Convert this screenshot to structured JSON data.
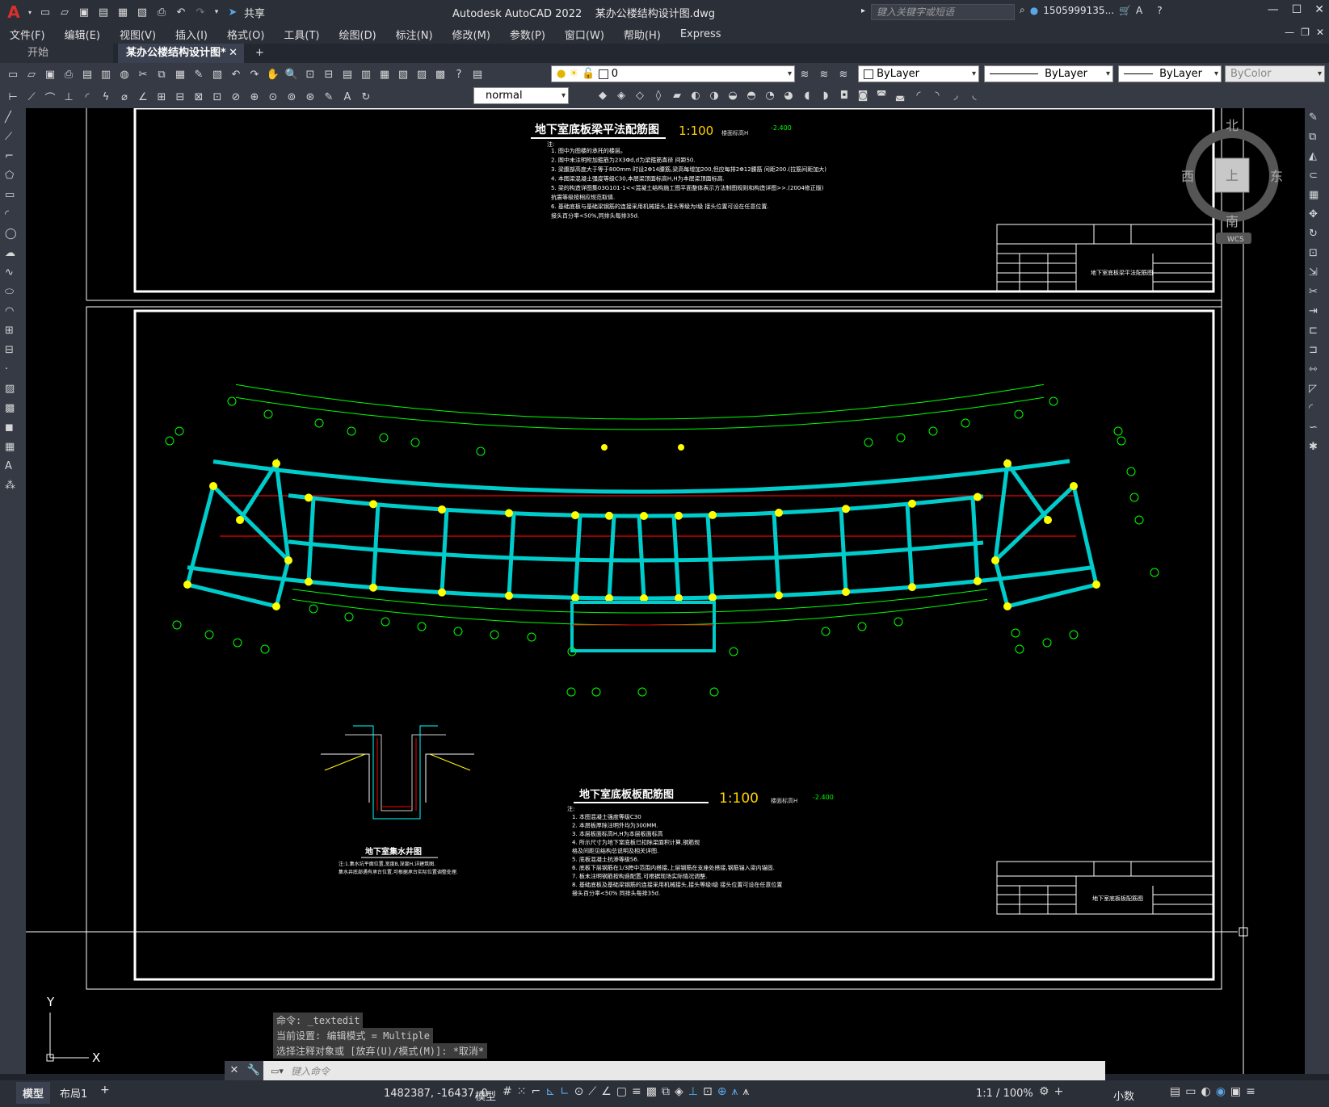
{
  "titlebar": {
    "app_title": "Autodesk AutoCAD 2022",
    "file_name": "某办公楼结构设计图.dwg",
    "share_label": "共享",
    "search_placeholder": "键入关键字或短语",
    "user": "1505999135..."
  },
  "menu": [
    "文件(F)",
    "编辑(E)",
    "视图(V)",
    "插入(I)",
    "格式(O)",
    "工具(T)",
    "绘图(D)",
    "标注(N)",
    "修改(M)",
    "参数(P)",
    "窗口(W)",
    "帮助(H)",
    "Express"
  ],
  "tabs": {
    "start": "开始",
    "document": "某办公楼结构设计图*"
  },
  "properties": {
    "layer": "0",
    "color": "ByLayer",
    "linetype": "ByLayer",
    "lineweight": "ByLayer",
    "plotstyle": "ByColor",
    "textstyle": "normal"
  },
  "viewcube": {
    "north": "北",
    "south": "南",
    "east": "东",
    "west": "西",
    "top": "上",
    "wcs": "WCS"
  },
  "drawing": {
    "top_title": "地下室底板梁平法配筋图",
    "top_scale": "1:100",
    "top_level_label": "楼面标高H",
    "top_level_value": "-2.400",
    "top_notes_head": "注:",
    "top_notes": [
      "1. 图中为图楼的承托的楼层。",
      "2. 图中未注明附加箍筋为2X3Φd,d为梁箍筋直径 间距50.",
      "3. 梁腹部高度大于等于800mm 时设2Φ14腰筋,梁高每增加200,但应每排2Φ12腰筋 间距200.(拉筋间距加大)",
      "4. 本图梁混凝土强度等级C30,本层梁顶面标高H,H为本层梁顶面标高.",
      "5. 梁的构造详图集03G101-1<<混凝土结构施工图平面整体表示方法制图规则和构造详图>>.(2004修正版)",
      "   抗震等级按相应规范取值.",
      "6. 基础底板与基础梁钢筋的连接采用机械接头,接头等级为I级 接头位置可设在任意位置.",
      "   接头百分率<50%,同排头每排35d."
    ],
    "top_tb_name": "地下室底板梁平法配筋图",
    "mid_title": "地下室底板板配筋图",
    "mid_scale": "1:100",
    "mid_level_label": "楼面标高H",
    "mid_level_value": "-2.400",
    "mid_notes_head": "注:",
    "mid_notes": [
      "1. 本图混凝土强度等级C30",
      "2. 本层板厚除注明外均为300MM.",
      "3. 本层板面标高H,H为本层板面标高",
      "4. 所示尺寸为地下室底板已扣除梁面积计算,钢筋规",
      "   格及间距见结构总说明及相关详图.",
      "5. 底板混凝土抗渗等级S6.",
      "6. 底板下层钢筋在1/3跨中范围内搭接,上层钢筋在支座处搭接,钢筋锚入梁内锚固.",
      "7. 板未注明钢筋按构造配置,可根据现场实际情况调整.",
      "8. 基础底板及基础梁钢筋的连接采用机械接头,接头等级I级 接头位置可设在任意位置",
      "   接头百分率<50% 同排头每排35d."
    ],
    "mid_tb_name": "地下室底板板配筋图",
    "sump_title": "地下室集水井图",
    "sump_note1": "注:1.集水坑平面位置,宽度B,深度H,详建筑图.",
    "sump_note2": "集水井底部遇有承台位置,可根据承台实际位置调整处理."
  },
  "command": {
    "history": [
      "命令: _textedit",
      "当前设置: 编辑模式 = Multiple",
      "选择注释对象或 [放弃(U)/模式(M)]: *取消*"
    ],
    "placeholder": "键入命令"
  },
  "ucs": {
    "x": "X",
    "y": "Y"
  },
  "layout_tabs": {
    "model": "模型",
    "layout1": "布局1",
    "add": "+"
  },
  "status": {
    "coords": "1482387, -16437, 0",
    "space": "模型",
    "scale": "1:1 / 100%",
    "units": "小数"
  }
}
